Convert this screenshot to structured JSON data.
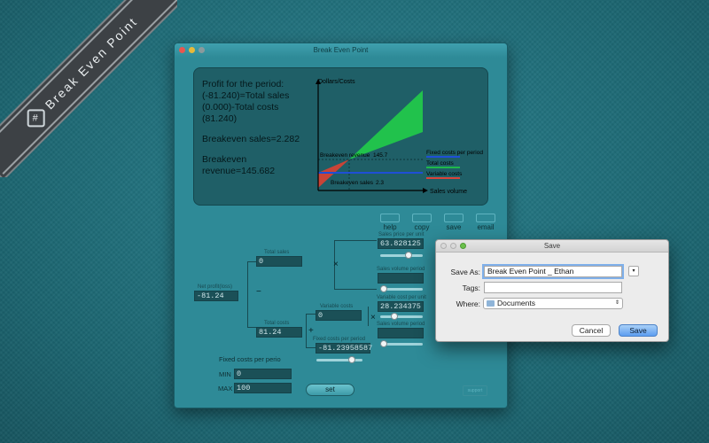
{
  "ribbon": {
    "text": "Break Even Point",
    "logo_icon": "grid-logo-icon"
  },
  "window": {
    "title": "Break Even Point"
  },
  "summary": {
    "profit": "Profit for the period:\n(-81.240)=Total sales (0.000)-Total costs (81.240)",
    "breakeven_sales": "Breakeven sales=2.282",
    "breakeven_revenue": "Breakeven revenue=145.682"
  },
  "chart_data": {
    "type": "area",
    "ylabel": "Dollars/Costs",
    "xlabel": "Sales volume",
    "annotations": {
      "breakeven_revenue": "Breakeven revenue",
      "breakeven_revenue_value": "145.7",
      "breakeven_sales": "Breakeven sales",
      "breakeven_sales_value": "2.3"
    },
    "legend": [
      "Fixed costs per period",
      "Total costs",
      "Variable costs"
    ],
    "legend_colors": [
      "#1f4fd6",
      "#1fb84a",
      "#d9443a"
    ],
    "series_colors": {
      "fixed": "#1f4fd6",
      "revenue_area": "#21c24c",
      "loss_area": "#c94437"
    }
  },
  "toolbar": [
    {
      "label": "help",
      "icon": "help-icon"
    },
    {
      "label": "copy",
      "icon": "copy-icon"
    },
    {
      "label": "save",
      "icon": "save-icon"
    },
    {
      "label": "email",
      "icon": "email-icon"
    }
  ],
  "tree": {
    "net_profit_label": "Net profit(loss)",
    "net_profit_value": "-81.24",
    "total_sales_label": "Total sales",
    "total_sales_value": "0",
    "total_costs_label": "Total costs",
    "total_costs_value": "81.24",
    "variable_costs_label": "Variable costs",
    "variable_costs_value": "0",
    "fixed_costs_label": "Fixed costs per period",
    "fixed_costs_value": "-81.23958587",
    "sales_price_label": "Sales price per unit",
    "sales_price_value": "63.828125",
    "sales_volume_label": "Sales volume period",
    "variable_cost_unit_label": "Variable cost per unit",
    "variable_cost_unit_value": "28.234375",
    "sales_volume2_label": "Sales volume period",
    "op_minus": "−",
    "op_plus": "+",
    "op_times": "×"
  },
  "range": {
    "title": "Fixed costs per perio",
    "min_label": "MIN",
    "min_value": "0",
    "max_label": "MAX",
    "max_value": "100",
    "set_label": "set",
    "support_label": "support"
  },
  "dialog": {
    "title": "Save",
    "save_as_label": "Save As:",
    "save_as_value": "Break Even Point _ Ethan",
    "tags_label": "Tags:",
    "tags_value": "",
    "where_label": "Where:",
    "where_value": "Documents",
    "cancel_label": "Cancel",
    "save_label": "Save"
  }
}
